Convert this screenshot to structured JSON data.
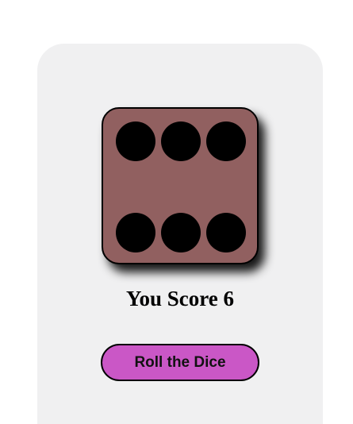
{
  "die": {
    "face_value": 6,
    "face_color": "#916060",
    "pip_color": "#000000"
  },
  "score_text": "You Score 6",
  "roll_button": {
    "label": "Roll the Dice",
    "color": "#ca57c6"
  }
}
